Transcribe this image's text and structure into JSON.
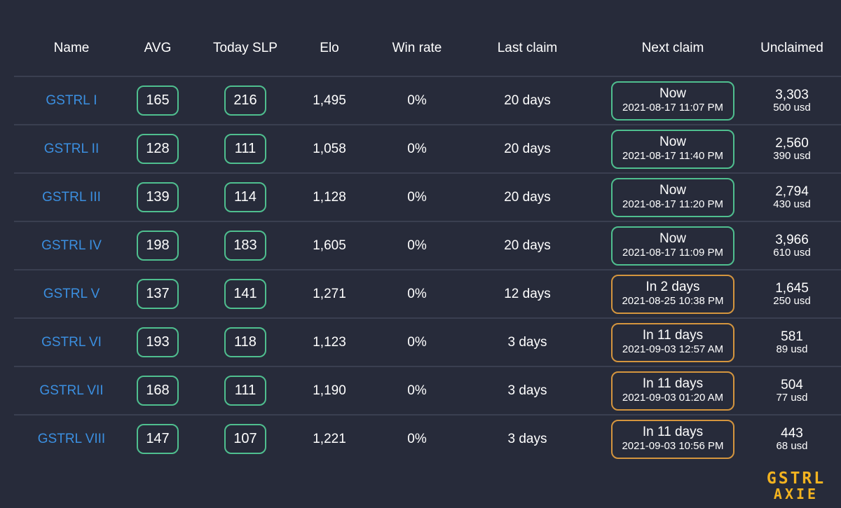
{
  "header": {
    "name": "Name",
    "avg": "AVG",
    "today_slp": "Today SLP",
    "elo": "Elo",
    "win_rate": "Win rate",
    "last_claim": "Last claim",
    "next_claim": "Next claim",
    "unclaimed": "Unclaimed"
  },
  "colors": {
    "background": "#272b3a",
    "link": "#3b8fe0",
    "green_border": "#4fbf8f",
    "orange_border": "#d4953e",
    "logo": "#f3b320"
  },
  "rows": [
    {
      "name": "GSTRL I",
      "avg": "165",
      "today": "216",
      "elo": "1,495",
      "win": "0%",
      "last": "20 days",
      "next": "Now",
      "next_date": "2021-08-17 11:07 PM",
      "next_status": "green",
      "unclaimed": "3,303",
      "usd": "500 usd"
    },
    {
      "name": "GSTRL II",
      "avg": "128",
      "today": "111",
      "elo": "1,058",
      "win": "0%",
      "last": "20 days",
      "next": "Now",
      "next_date": "2021-08-17 11:40 PM",
      "next_status": "green",
      "unclaimed": "2,560",
      "usd": "390 usd"
    },
    {
      "name": "GSTRL III",
      "avg": "139",
      "today": "114",
      "elo": "1,128",
      "win": "0%",
      "last": "20 days",
      "next": "Now",
      "next_date": "2021-08-17 11:20 PM",
      "next_status": "green",
      "unclaimed": "2,794",
      "usd": "430 usd"
    },
    {
      "name": "GSTRL IV",
      "avg": "198",
      "today": "183",
      "elo": "1,605",
      "win": "0%",
      "last": "20 days",
      "next": "Now",
      "next_date": "2021-08-17 11:09 PM",
      "next_status": "green",
      "unclaimed": "3,966",
      "usd": "610 usd"
    },
    {
      "name": "GSTRL V",
      "avg": "137",
      "today": "141",
      "elo": "1,271",
      "win": "0%",
      "last": "12 days",
      "next": "In 2 days",
      "next_date": "2021-08-25 10:38 PM",
      "next_status": "orange",
      "unclaimed": "1,645",
      "usd": "250 usd"
    },
    {
      "name": "GSTRL VI",
      "avg": "193",
      "today": "118",
      "elo": "1,123",
      "win": "0%",
      "last": "3 days",
      "next": "In 11 days",
      "next_date": "2021-09-03 12:57 AM",
      "next_status": "orange",
      "unclaimed": "581",
      "usd": "89 usd"
    },
    {
      "name": "GSTRL VII",
      "avg": "168",
      "today": "111",
      "elo": "1,190",
      "win": "0%",
      "last": "3 days",
      "next": "In 11 days",
      "next_date": "2021-09-03 01:20 AM",
      "next_status": "orange",
      "unclaimed": "504",
      "usd": "77 usd"
    },
    {
      "name": "GSTRL VIII",
      "avg": "147",
      "today": "107",
      "elo": "1,221",
      "win": "0%",
      "last": "3 days",
      "next": "In 11 days",
      "next_date": "2021-09-03 10:56 PM",
      "next_status": "orange",
      "unclaimed": "443",
      "usd": "68 usd"
    }
  ],
  "logo": {
    "line1": "GSTRL",
    "line2": "AXIE"
  }
}
